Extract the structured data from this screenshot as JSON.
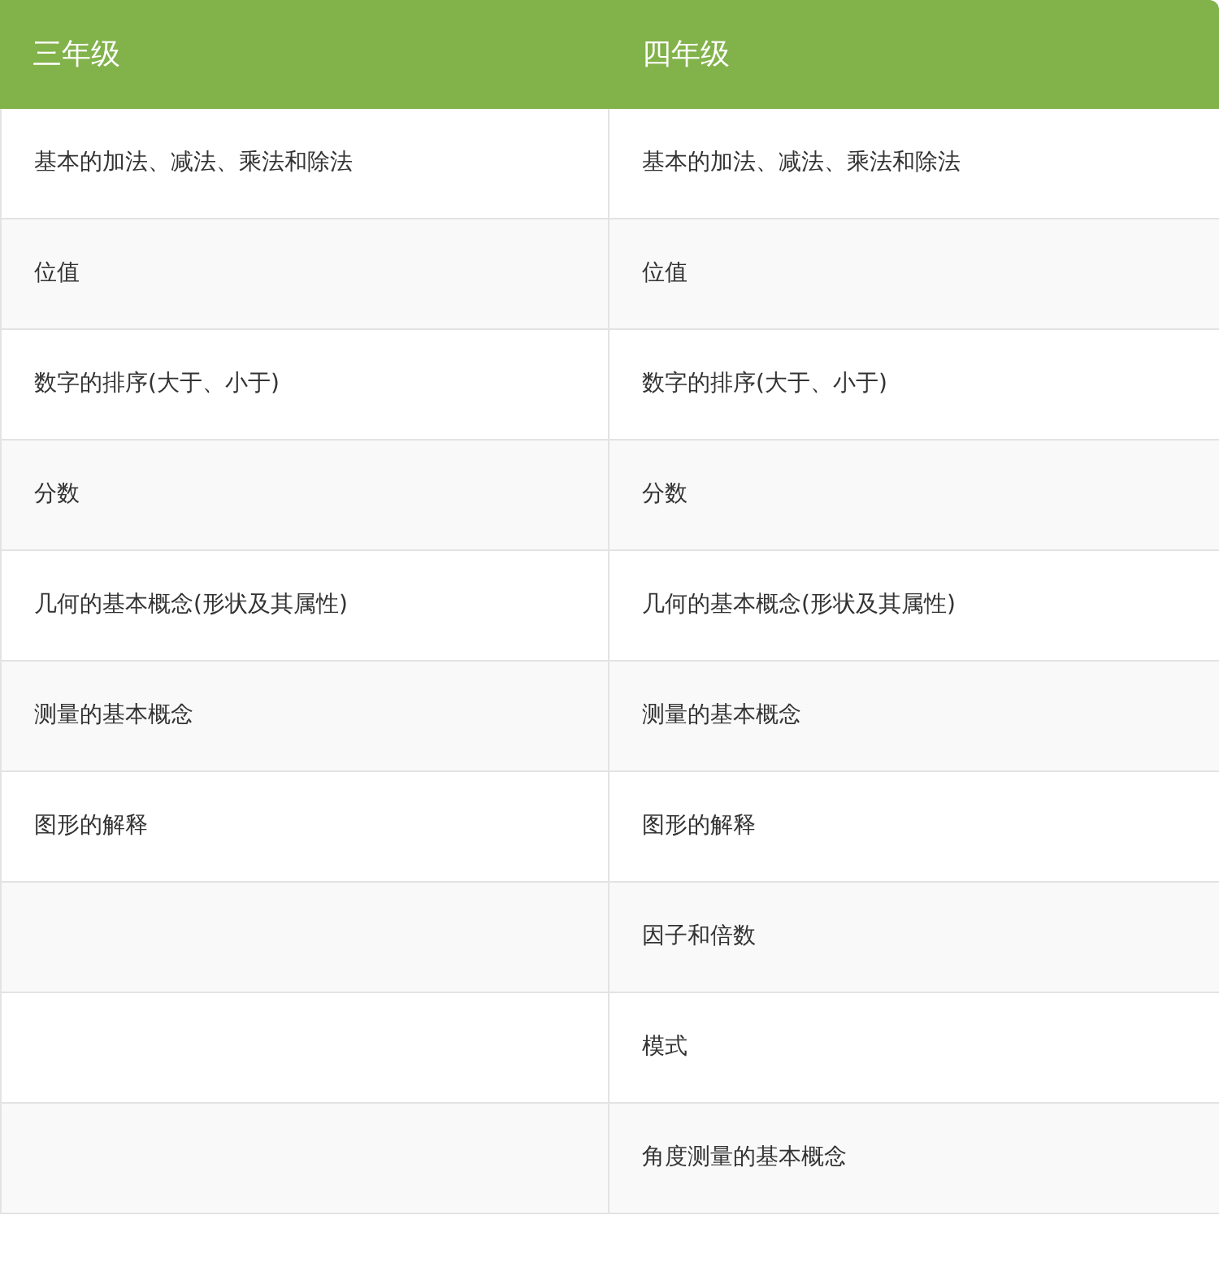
{
  "table": {
    "columns": [
      "三年级",
      "四年级"
    ],
    "rows": [
      {
        "column_1": "基本的加法、减法、乘法和除法",
        "column_2": "基本的加法、减法、乘法和除法"
      },
      {
        "column_1": "位值",
        "column_2": "位值"
      },
      {
        "column_1": "数字的排序(大于、小于)",
        "column_2": "数字的排序(大于、小于)"
      },
      {
        "column_1": "分数",
        "column_2": "分数"
      },
      {
        "column_1": "几何的基本概念(形状及其属性)",
        "column_2": "几何的基本概念(形状及其属性)"
      },
      {
        "column_1": "测量的基本概念",
        "column_2": "测量的基本概念"
      },
      {
        "column_1": "图形的解释",
        "column_2": "图形的解释"
      },
      {
        "column_2": "因子和倍数"
      },
      {
        "column_2": "模式"
      },
      {
        "column_2": "角度测量的基本概念"
      }
    ]
  }
}
